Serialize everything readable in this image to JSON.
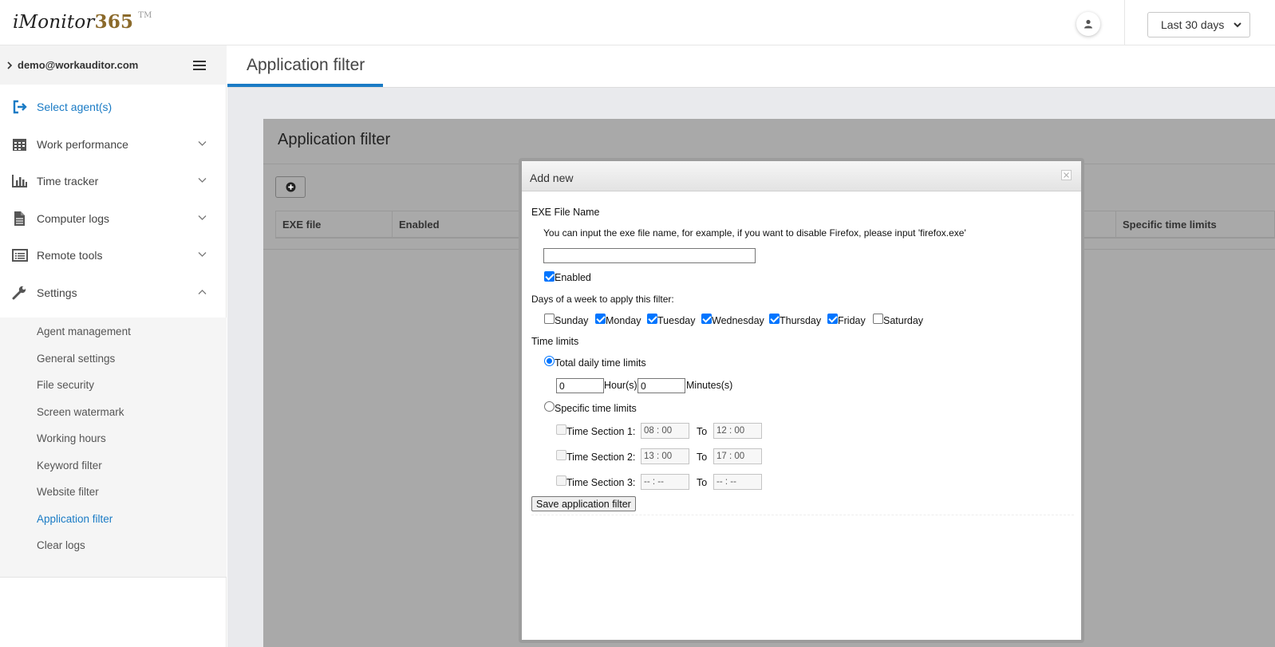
{
  "app": {
    "logo_text": "iMonitor",
    "logo_number": "365",
    "logo_tm": "TM",
    "date_range": "Last 30 days"
  },
  "sidebar": {
    "account": "demo@workauditor.com",
    "select_agents": "Select agent(s)",
    "items": [
      {
        "label": "Work performance",
        "icon": "calendar-icon"
      },
      {
        "label": "Time tracker",
        "icon": "bar-chart-icon"
      },
      {
        "label": "Computer logs",
        "icon": "document-icon"
      },
      {
        "label": "Remote tools",
        "icon": "list-window-icon"
      },
      {
        "label": "Settings",
        "icon": "wrench-icon"
      }
    ],
    "settings_submenu": [
      "Agent management",
      "General settings",
      "File security",
      "Screen watermark",
      "Working hours",
      "Keyword filter",
      "Website filter",
      "Application filter",
      "Clear logs"
    ],
    "active_submenu": "Application filter"
  },
  "page": {
    "title": "Application filter",
    "panel_title": "Application filter",
    "table_headers": [
      "EXE file",
      "Enabled",
      "Specific time limits"
    ]
  },
  "modal": {
    "title": "Add new",
    "exe_label": "EXE File Name",
    "exe_hint": "You can input the exe file name, for example, if you want to disable Firefox, please input 'firefox.exe'",
    "exe_value": "",
    "enabled_label": "Enabled",
    "enabled": true,
    "days_label": "Days of a week to apply this filter:",
    "days": [
      {
        "label": "Sunday",
        "checked": false
      },
      {
        "label": "Monday",
        "checked": true
      },
      {
        "label": "Tuesday",
        "checked": true
      },
      {
        "label": "Wednesday",
        "checked": true
      },
      {
        "label": "Thursday",
        "checked": true
      },
      {
        "label": "Friday",
        "checked": true
      },
      {
        "label": "Saturday",
        "checked": false
      }
    ],
    "time_limits_label": "Time limits",
    "total_daily_label": "Total daily time limits",
    "total_daily_selected": true,
    "hours_value": "0",
    "hours_unit": "Hour(s)",
    "minutes_value": "0",
    "minutes_unit": "Minutes(s)",
    "specific_label": "Specific time limits",
    "sections": [
      {
        "label": "Time Section 1:",
        "from": "08 : 00",
        "to": "12 : 00"
      },
      {
        "label": "Time Section 2:",
        "from": "13 : 00",
        "to": "17 : 00"
      },
      {
        "label": "Time Section 3:",
        "from": "-- : --",
        "to": "-- : --"
      }
    ],
    "to_label": "To",
    "save_label": "Save application filter"
  },
  "colors": {
    "accent": "#1a7bc5",
    "logo_number": "#8b6a2b",
    "overlay_panel": "#a9a9a9",
    "checkbox_checked": "#0075ff"
  }
}
